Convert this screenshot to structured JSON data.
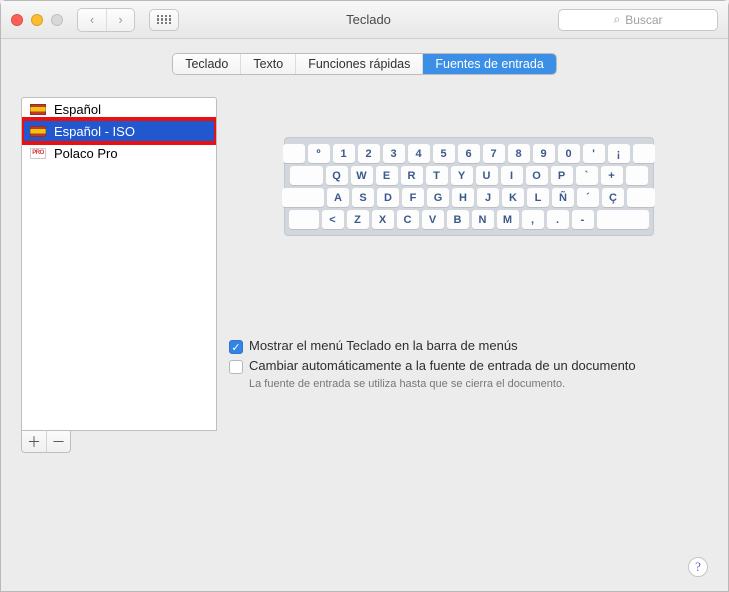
{
  "window": {
    "title": "Teclado"
  },
  "search": {
    "placeholder": "Buscar"
  },
  "tabs": [
    {
      "label": "Teclado",
      "selected": false
    },
    {
      "label": "Texto",
      "selected": false
    },
    {
      "label": "Funciones rápidas",
      "selected": false
    },
    {
      "label": "Fuentes de entrada",
      "selected": true
    }
  ],
  "sources": [
    {
      "label": "Español",
      "flag": "es",
      "selected": false,
      "highlighted": false
    },
    {
      "label": "Español - ISO",
      "flag": "es",
      "selected": true,
      "highlighted": true
    },
    {
      "label": "Polaco Pro",
      "flag": "pro",
      "selected": false,
      "highlighted": false
    }
  ],
  "keyboard": {
    "rows": [
      [
        "º",
        "1",
        "2",
        "3",
        "4",
        "5",
        "6",
        "7",
        "8",
        "9",
        "0",
        "'",
        "¡"
      ],
      [
        "Q",
        "W",
        "E",
        "R",
        "T",
        "Y",
        "U",
        "I",
        "O",
        "P",
        "`",
        "+"
      ],
      [
        "A",
        "S",
        "D",
        "F",
        "G",
        "H",
        "J",
        "K",
        "L",
        "Ñ",
        "´",
        "Ç"
      ],
      [
        "<",
        "Z",
        "X",
        "C",
        "V",
        "B",
        "N",
        "M",
        ",",
        ".",
        "-"
      ]
    ]
  },
  "options": {
    "show_keyboard_menu": {
      "label": "Mostrar el menú Teclado en la barra de menús",
      "checked": true
    },
    "auto_switch": {
      "label": "Cambiar automáticamente a la fuente de entrada de un documento",
      "checked": false
    },
    "note": "La fuente de entrada se utiliza hasta que se cierra el documento."
  },
  "icons": {
    "pro": "PRO",
    "check": "✓",
    "help": "?",
    "plus": "＋",
    "minus": "－",
    "search": "⌕",
    "back": "‹",
    "forward": "›"
  }
}
